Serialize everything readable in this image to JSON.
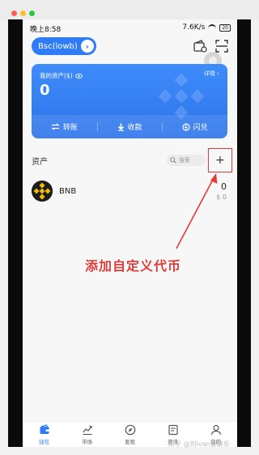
{
  "status_bar": {
    "time": "晚上8:58",
    "speed": "7.6K/s",
    "battery": "20"
  },
  "header": {
    "wallet_name": "Bsc(lowb)"
  },
  "balance_card": {
    "label": "我的资产($)",
    "detail_link": "详情",
    "balance": "0",
    "actions": [
      {
        "label": "转账",
        "icon": "transfer-icon"
      },
      {
        "label": "收款",
        "icon": "receive-icon"
      },
      {
        "label": "闪兑",
        "icon": "swap-icon"
      }
    ]
  },
  "assets": {
    "title": "资产",
    "search_placeholder": "搜索",
    "add_symbol": "+",
    "tokens": [
      {
        "name": "BNB",
        "amount": "0",
        "usd": "$ 0"
      }
    ]
  },
  "annotation": {
    "text": "添加自定义代币",
    "color": "#e53935"
  },
  "tabbar": {
    "items": [
      {
        "label": "钱包",
        "icon": "wallet-icon",
        "active": true
      },
      {
        "label": "市场",
        "icon": "chart-icon",
        "active": false
      },
      {
        "label": "发现",
        "icon": "compass-icon",
        "active": false
      },
      {
        "label": "资讯",
        "icon": "news-icon",
        "active": false
      },
      {
        "label": "我的",
        "icon": "user-icon",
        "active": false
      }
    ]
  },
  "watermark": "知乎 @刘Ivan爱聊币",
  "colors": {
    "accent": "#2f7cf6",
    "annotation_red": "#e53935"
  }
}
